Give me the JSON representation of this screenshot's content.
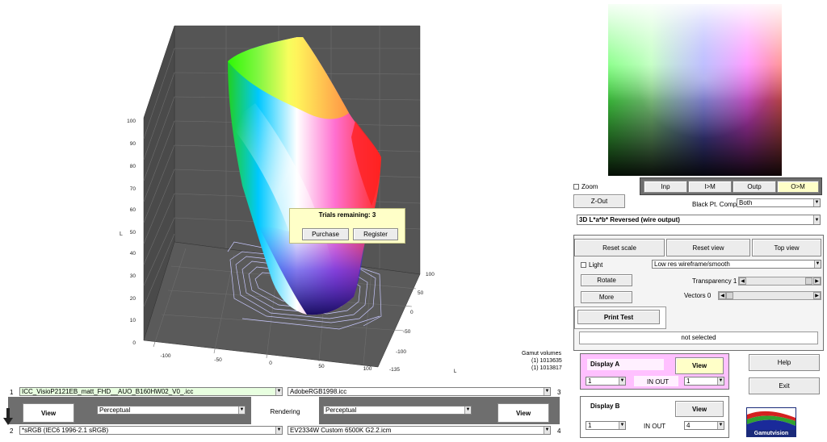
{
  "plot": {
    "axis_label_left": "L",
    "axis_label_right": "L",
    "z_ticks": [
      "100",
      "90",
      "80",
      "70",
      "60",
      "50",
      "40",
      "30",
      "20",
      "10",
      "0"
    ],
    "x_ticks": [
      "-100",
      "-50",
      "0",
      "50",
      "100"
    ],
    "y_ticks": [
      "100",
      "50",
      "0",
      "-50",
      "-100",
      "-135"
    ]
  },
  "gamut": {
    "title": "Gamut volumes",
    "v1": "(1) 1013635",
    "v2": "(1) 1013817"
  },
  "trial": {
    "text": "Trials remaining: 3",
    "purchase": "Purchase",
    "register": "Register"
  },
  "right": {
    "zoom": "Zoom",
    "zout": "Z-Out",
    "tabs": [
      "Inp",
      "I>M",
      "Outp",
      "O>M"
    ],
    "bpc_label": "Black Pt. Comp.",
    "bpc_value": "Both",
    "mode": "3D L*a*b* Reversed (wire output)",
    "reset_scale": "Reset scale",
    "reset_view": "Reset view",
    "top_view": "Top view",
    "light": "Light",
    "res_value": "Low res wireframe/smooth",
    "rotate": "Rotate",
    "transparency": "Transparency 1",
    "more": "More",
    "vectors": "Vectors 0",
    "print_test": "Print Test",
    "status": "not selected",
    "display_a": "Display A",
    "display_b": "Display B",
    "view": "View",
    "in_out": "IN  OUT",
    "a_in": "1",
    "a_out": "1",
    "b_in": "1",
    "b_out": "4",
    "help": "Help",
    "exit": "Exit",
    "logo": "Gamutvision"
  },
  "bottom": {
    "n1": "1",
    "n2": "2",
    "n3": "3",
    "n4": "4",
    "profile1": "ICC_VisioP2121EB_matt_FHD__AUO_B160HW02_V0_.icc",
    "profile2": "*sRGB  (IEC6 1996-2.1 sRGB)",
    "profile3": "AdobeRGB1998.icc",
    "profile4": "EV2334W Custom 6500K G2.2.icm",
    "view": "View",
    "intent_left": "Perceptual",
    "rendering": "Rendering",
    "intent_right": "Perceptual"
  }
}
